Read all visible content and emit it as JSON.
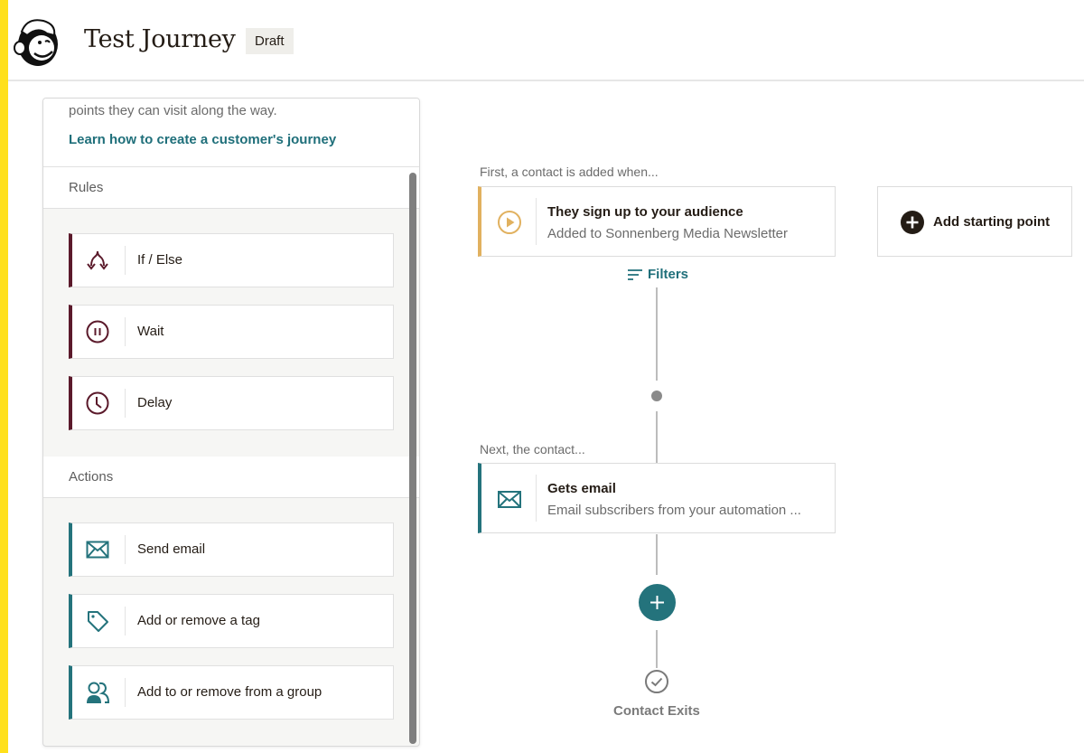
{
  "header": {
    "logo": "mailchimp-freddie-logo",
    "title": "Test Journey",
    "status_badge": "Draft"
  },
  "panel": {
    "intro_text": "points they can visit along the way.",
    "learn_link": "Learn how to create a customer's journey",
    "sections": [
      {
        "title": "Rules",
        "items": [
          {
            "label": "If / Else",
            "icon": "split-arrows-icon"
          },
          {
            "label": "Wait",
            "icon": "pause-circle-icon"
          },
          {
            "label": "Delay",
            "icon": "clock-icon"
          }
        ]
      },
      {
        "title": "Actions",
        "items": [
          {
            "label": "Send email",
            "icon": "envelope-icon"
          },
          {
            "label": "Add or remove a tag",
            "icon": "tag-icon"
          },
          {
            "label": "Add to or remove from a group",
            "icon": "group-icon"
          }
        ]
      }
    ]
  },
  "canvas": {
    "start_label": "First, a contact is added when...",
    "trigger": {
      "title": "They sign up to your audience",
      "subtitle": "Added to Sonnenberg Media Newsletter",
      "icon": "play-circle-icon"
    },
    "add_starting_point": "Add starting point",
    "filters": "Filters",
    "next_label": "Next, the contact...",
    "action": {
      "title": "Gets email",
      "subtitle": "Email subscribers from your automation ...",
      "icon": "envelope-icon"
    },
    "exit_label": "Contact Exits"
  },
  "colors": {
    "brand_yellow": "#ffe01b",
    "rule_accent": "#5b1a2b",
    "action_accent": "#24737c",
    "trigger_accent": "#e1b15f",
    "link": "#1f6f7a"
  }
}
